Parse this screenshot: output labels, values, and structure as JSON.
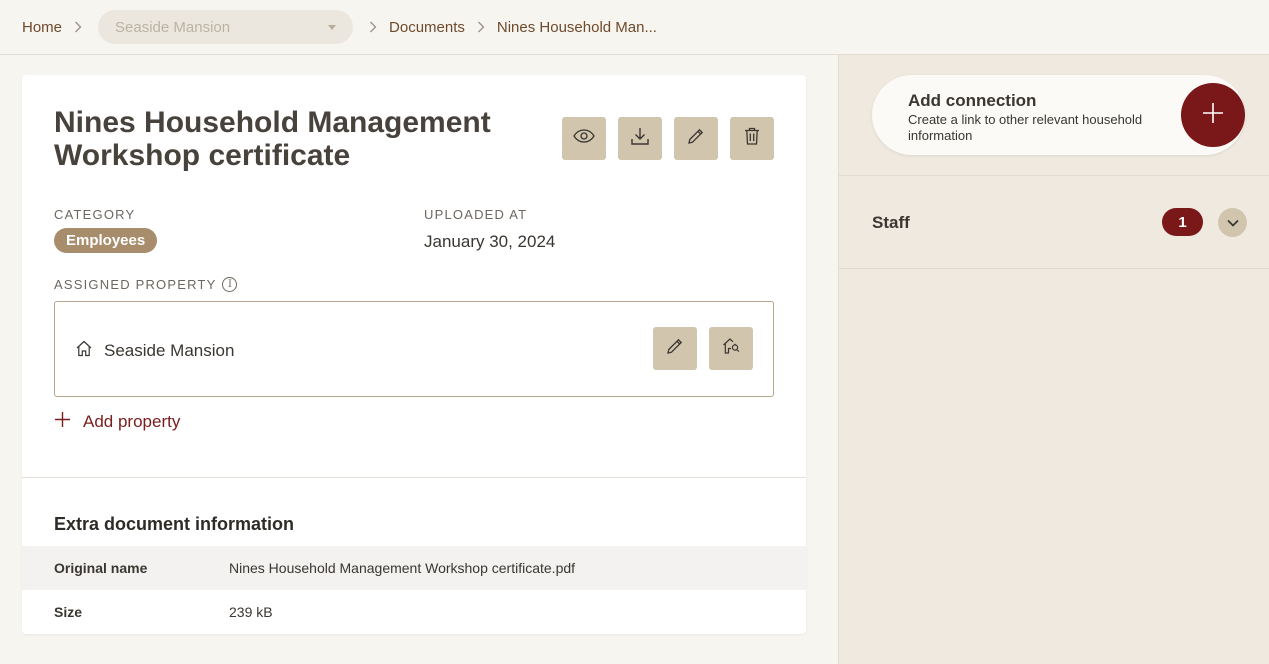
{
  "breadcrumb": {
    "home": "Home",
    "property_select": "Seaside Mansion",
    "documents": "Documents",
    "current": "Nines Household Man..."
  },
  "document": {
    "title": "Nines Household Management Workshop certificate",
    "category_label": "CATEGORY",
    "category_value": "Employees",
    "uploaded_label": "UPLOADED AT",
    "uploaded_value": "January 30, 2024",
    "assigned_label": "ASSIGNED PROPERTY",
    "assigned_property": "Seaside Mansion",
    "add_property_label": "Add property",
    "actions": [
      "eye-icon",
      "download-icon",
      "pencil-icon",
      "trash-icon"
    ]
  },
  "extra_info": {
    "title": "Extra document information",
    "rows": [
      {
        "key": "Original name",
        "value": "Nines Household Management Workshop certificate.pdf"
      },
      {
        "key": "Size",
        "value": "239 kB"
      }
    ]
  },
  "sidebar": {
    "connection_title": "Add connection",
    "connection_subtitle": "Create a link to other relevant household information",
    "staff_label": "Staff",
    "staff_count": "1"
  },
  "colors": {
    "accent": "#7a1718",
    "button_bg": "#d2c5ae",
    "badge_bg": "#a88d6c",
    "link": "#7a1d1c"
  }
}
